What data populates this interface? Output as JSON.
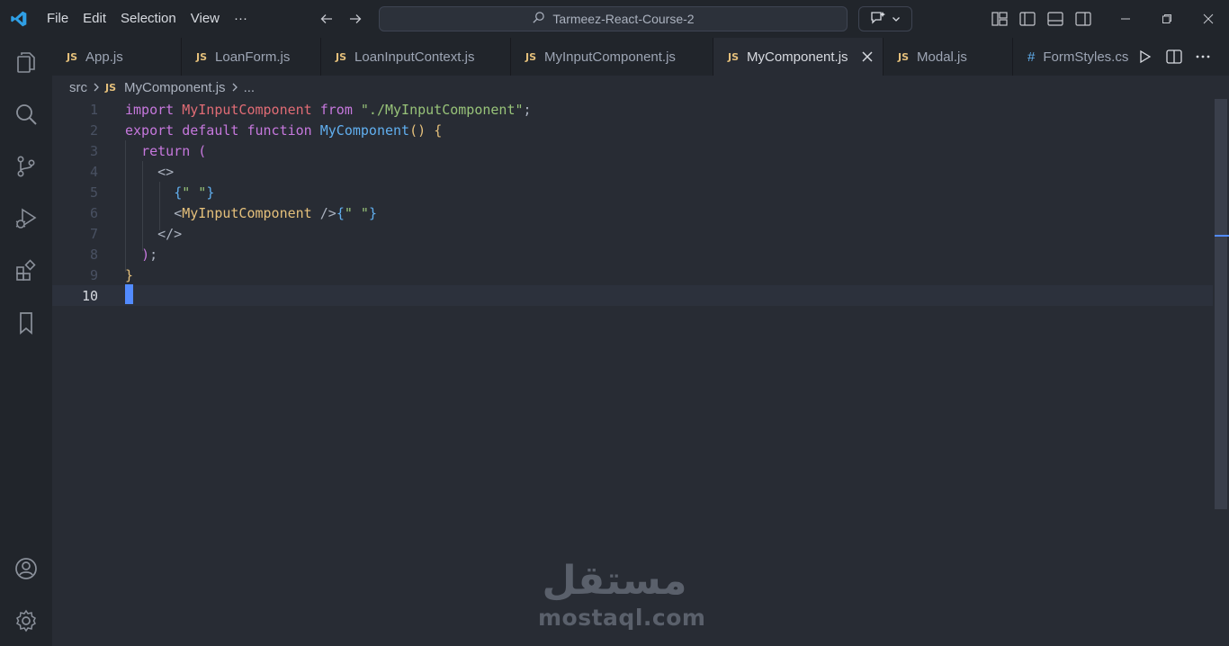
{
  "menu": [
    "File",
    "Edit",
    "Selection",
    "View",
    "···"
  ],
  "search": {
    "label": "Tarmeez-React-Course-2"
  },
  "tabs": [
    {
      "label": "App.js",
      "badge": "JS"
    },
    {
      "label": "LoanForm.js",
      "badge": "JS"
    },
    {
      "label": "LoanInputContext.js",
      "badge": "JS"
    },
    {
      "label": "MyInputComponent.js",
      "badge": "JS"
    },
    {
      "label": "MyComponent.js",
      "badge": "JS",
      "active": true
    },
    {
      "label": "Modal.js",
      "badge": "JS"
    },
    {
      "label": "FormStyles.cs",
      "badge": "#"
    }
  ],
  "breadcrumb": {
    "folder": "src",
    "badge": "JS",
    "file": "MyComponent.js",
    "more": "..."
  },
  "line_numbers": [
    "1",
    "2",
    "3",
    "4",
    "5",
    "6",
    "7",
    "8",
    "9",
    "10"
  ],
  "code": {
    "l1": {
      "kw1": "import",
      "id": "MyInputComponent",
      "kw2": "from",
      "str": "\"./MyInputComponent\"",
      "end": ";"
    },
    "l2": {
      "kw1": "export",
      "kw2": "default",
      "kw3": "function",
      "fn": "MyComponent",
      "parens": "()",
      "brace": "{"
    },
    "l3": {
      "kw": "return",
      "paren": "("
    },
    "l4": {
      "text": "<>"
    },
    "l5": {
      "open": "{",
      "str": "\" \"",
      "close": "}"
    },
    "l6": {
      "lt": "<",
      "tag": "MyInputComponent",
      "end": " />",
      "open": "{",
      "str": "\" \"",
      "close": "}"
    },
    "l7": {
      "text": "</>"
    },
    "l8": {
      "paren": ")",
      "end": ";"
    },
    "l9": {
      "brace": "}"
    }
  },
  "watermark": {
    "logo": "مستقل",
    "text": "mostaql.com"
  },
  "colors": {
    "background": "#282c34",
    "chrome": "#21252b",
    "accent": "#528bff"
  }
}
